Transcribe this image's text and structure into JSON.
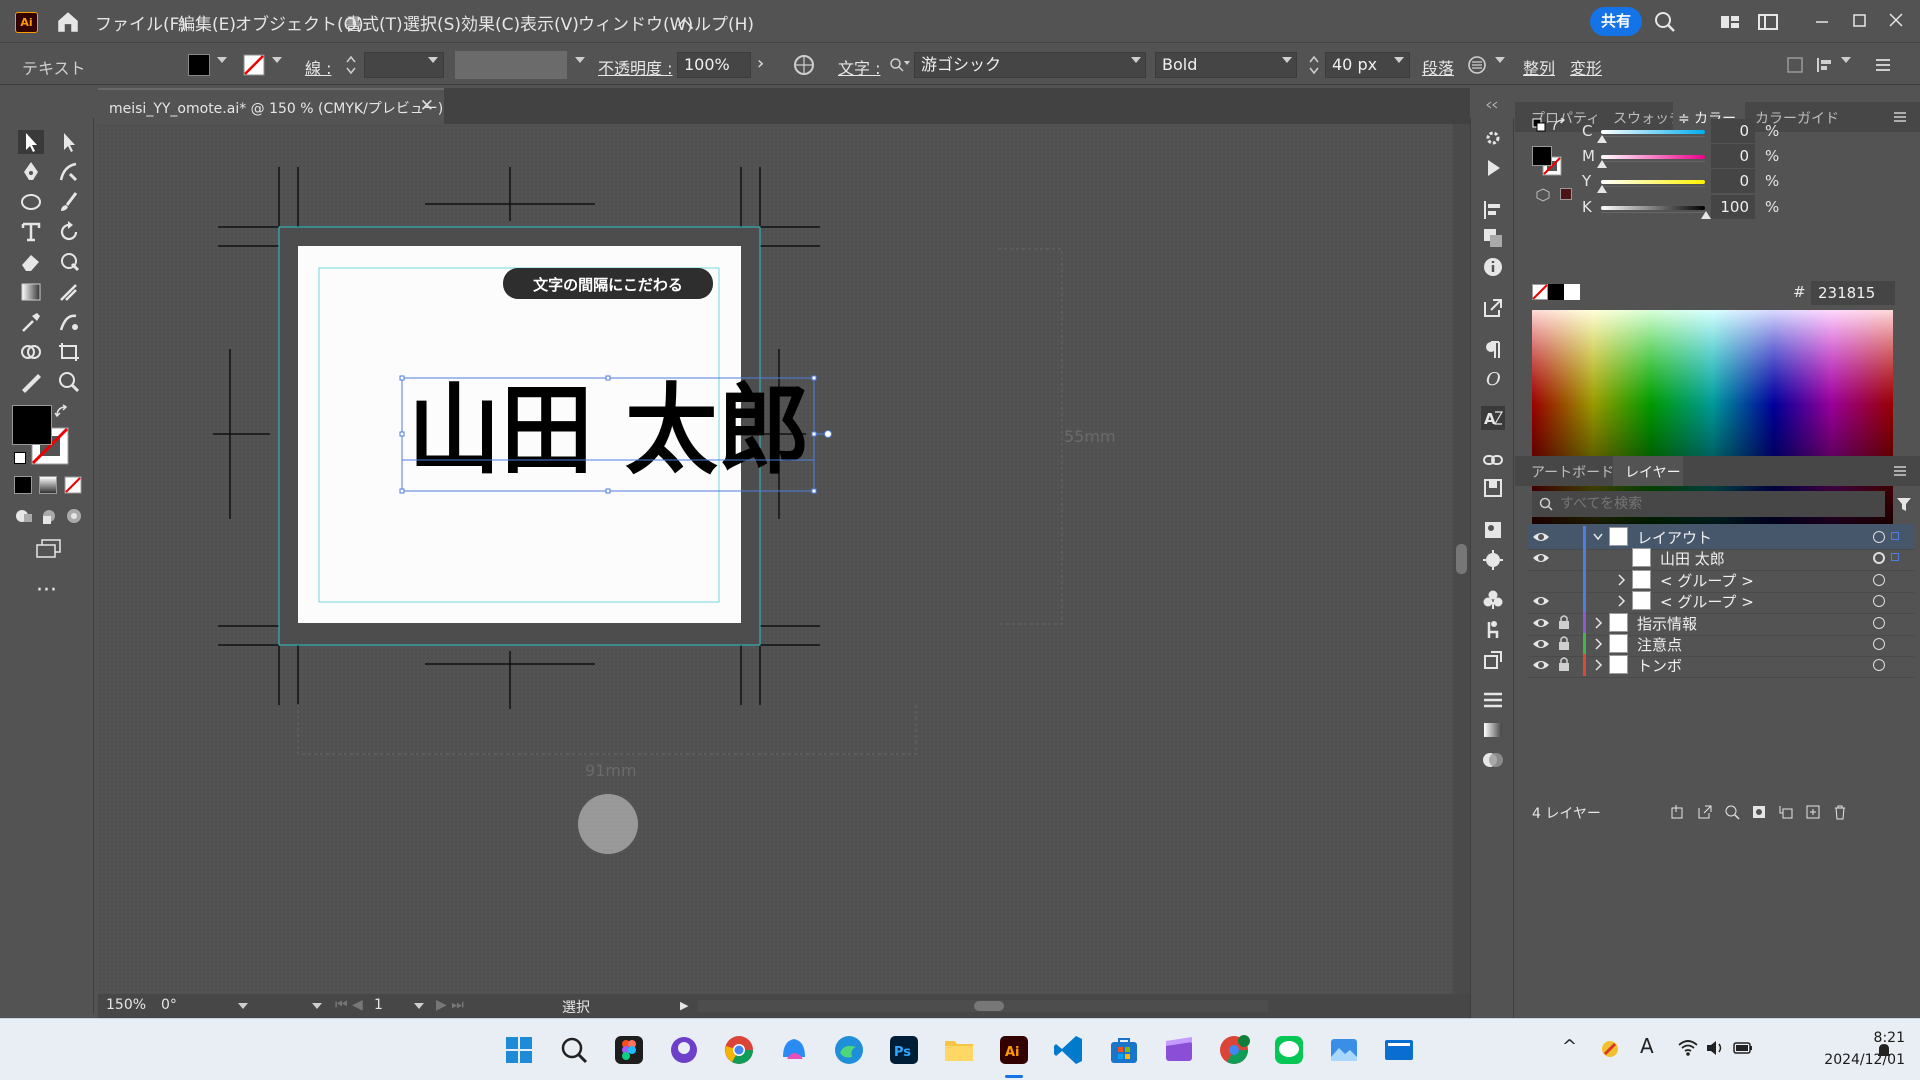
{
  "app": {
    "logo": "Ai"
  },
  "menu": {
    "items": [
      "ファイル(F)",
      "編集(E)",
      "オブジェクト(O)",
      "書式(T)",
      "選択(S)",
      "効果(C)",
      "表示(V)",
      "ウィンドウ(W)",
      "ヘルプ(H)"
    ],
    "share_label": "共有"
  },
  "control": {
    "mode_label": "テキスト",
    "stroke_label": "線 :",
    "opacity_label": "不透明度 :",
    "opacity_value": "100%",
    "char_label": "文字 :",
    "font_family": "游ゴシック",
    "font_style": "Bold",
    "font_size": "40 px",
    "paragraph_label": "段落",
    "align_label": "整列",
    "transform_label": "変形"
  },
  "document": {
    "tab_title": "meisi_YY_omote.ai* @ 150 % (CMYK/プレビュー)",
    "close_glyph": "✕"
  },
  "artboard": {
    "badge_text": "文字の間隔にこだわる",
    "name_text": "山田 太郎",
    "dim_right": "55mm",
    "dim_bottom": "91mm"
  },
  "status": {
    "zoom": "150%",
    "rotation": "0°",
    "artboard_num": "1",
    "tool_name": "選択"
  },
  "color_panel": {
    "tabs": [
      "プロパティ",
      "スウォッチ",
      "≑ カラー",
      "カラーガイド"
    ],
    "active_tab": "≑ カラー",
    "channels": [
      {
        "label": "C",
        "value": "0",
        "unit": "%",
        "color": "#00aeef"
      },
      {
        "label": "M",
        "value": "0",
        "unit": "%",
        "color": "#ec008c"
      },
      {
        "label": "Y",
        "value": "0",
        "unit": "%",
        "color": "#fff200"
      },
      {
        "label": "K",
        "value": "100",
        "unit": "%",
        "color": "#000000"
      }
    ],
    "hex_label": "#",
    "hex_value": "231815"
  },
  "layers_panel": {
    "tabs": [
      "アートボード",
      "レイヤー"
    ],
    "active_tab": "レイヤー",
    "search_placeholder": "すべてを検索",
    "rows": [
      {
        "name": "レイアウト",
        "visible": true,
        "locked": false,
        "expanded": true,
        "color": "#4f7de0"
      },
      {
        "name": "山田 太郎",
        "visible": true,
        "locked": false,
        "expanded": false,
        "color": "#4f7de0"
      },
      {
        "name": "< グループ >",
        "visible": false,
        "locked": false,
        "expanded": false,
        "color": "#4f7de0"
      },
      {
        "name": "< グループ >",
        "visible": true,
        "locked": false,
        "expanded": false,
        "color": "#4f7de0"
      },
      {
        "name": "指示情報",
        "visible": true,
        "locked": true,
        "expanded": false,
        "color": "#8a5ad4"
      },
      {
        "name": "注意点",
        "visible": true,
        "locked": true,
        "expanded": false,
        "color": "#3fb74b"
      },
      {
        "name": "トンボ",
        "visible": true,
        "locked": true,
        "expanded": false,
        "color": "#d9493d"
      }
    ],
    "footer_count": "4 レイヤー"
  },
  "taskbar": {
    "time": "8:21",
    "date": "2024/12/01",
    "apps": [
      "start",
      "search",
      "figma",
      "github-desktop",
      "chrome",
      "copilot",
      "edge",
      "photoshop",
      "file-explorer",
      "illustrator",
      "vscode",
      "store",
      "clapper",
      "chrome-profile",
      "line",
      "photos",
      "remote"
    ]
  }
}
